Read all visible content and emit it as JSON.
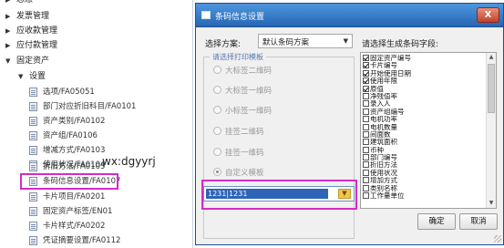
{
  "nav": {
    "rows": [
      {
        "label": "总账",
        "kind": "group",
        "expanded": false
      },
      {
        "label": "发票管理",
        "kind": "group",
        "expanded": false
      },
      {
        "label": "应收款管理",
        "kind": "group",
        "expanded": false
      },
      {
        "label": "应付款管理",
        "kind": "group",
        "expanded": false
      },
      {
        "label": "固定资产",
        "kind": "group",
        "expanded": true
      },
      {
        "label": "设置",
        "kind": "subgroup",
        "expanded": true
      },
      {
        "label": "选项/FA05051",
        "kind": "leaf"
      },
      {
        "label": "部门对应折旧科目/FA0101",
        "kind": "leaf"
      },
      {
        "label": "资产类别/FA0102",
        "kind": "leaf"
      },
      {
        "label": "资产组/FA0106",
        "kind": "leaf"
      },
      {
        "label": "增减方式/FA0103",
        "kind": "leaf"
      },
      {
        "label": "使用状况/FA0104",
        "kind": "leaf"
      },
      {
        "label": "折旧方法/FA0105",
        "kind": "leaf"
      },
      {
        "label": "条码信息设置/FA0107",
        "kind": "leaf",
        "selected": true
      },
      {
        "label": "卡片项目/FA0201",
        "kind": "leaf"
      },
      {
        "label": "固定资产标签/EN01",
        "kind": "leaf"
      },
      {
        "label": "卡片样式/FA0202",
        "kind": "leaf"
      },
      {
        "label": "凭证摘要设置/FA0112",
        "kind": "leaf"
      }
    ],
    "watermark": "wx:dgyyrj"
  },
  "dialog": {
    "title": "条码信息设置",
    "close_label": "X",
    "scheme_label": "选择方案:",
    "scheme_value": "默认条码方案",
    "template_legend": "请选择打印模板",
    "templates": [
      {
        "label": "大标签二维码",
        "selected": false
      },
      {
        "label": "大标签一维码",
        "selected": false
      },
      {
        "label": "小标签一维码",
        "selected": false
      },
      {
        "label": "挂签二维码",
        "selected": false
      },
      {
        "label": "挂签一维码",
        "selected": false
      },
      {
        "label": "自定义模板",
        "selected": true
      }
    ],
    "custom_template_value": "1231|1231",
    "fields_label": "请选择生成条码字段:",
    "fields": [
      {
        "label": "固定资产编号",
        "checked": true
      },
      {
        "label": "卡片编号",
        "checked": true
      },
      {
        "label": "开始使用日期",
        "checked": true
      },
      {
        "label": "使用年限",
        "checked": true
      },
      {
        "label": "原值",
        "checked": true
      },
      {
        "label": "净残值率",
        "checked": false
      },
      {
        "label": "录入人",
        "checked": false
      },
      {
        "label": "资产组编号",
        "checked": false
      },
      {
        "label": "电机功率",
        "checked": false
      },
      {
        "label": "电机数量",
        "checked": false
      },
      {
        "label": "间面数",
        "checked": false
      },
      {
        "label": "建筑面积",
        "checked": false
      },
      {
        "label": "币种",
        "checked": false
      },
      {
        "label": "部门编号",
        "checked": false
      },
      {
        "label": "折旧方法",
        "checked": false
      },
      {
        "label": "使用状况",
        "checked": false
      },
      {
        "label": "增加方式",
        "checked": false
      },
      {
        "label": "类别名称",
        "checked": false
      },
      {
        "label": "工作量单位",
        "checked": false
      }
    ],
    "ok_label": "确定",
    "cancel_label": "取消"
  },
  "colors": {
    "highlight": "#d32cc8",
    "titlebar": "#2f73c2",
    "selection": "#2e63b8"
  }
}
